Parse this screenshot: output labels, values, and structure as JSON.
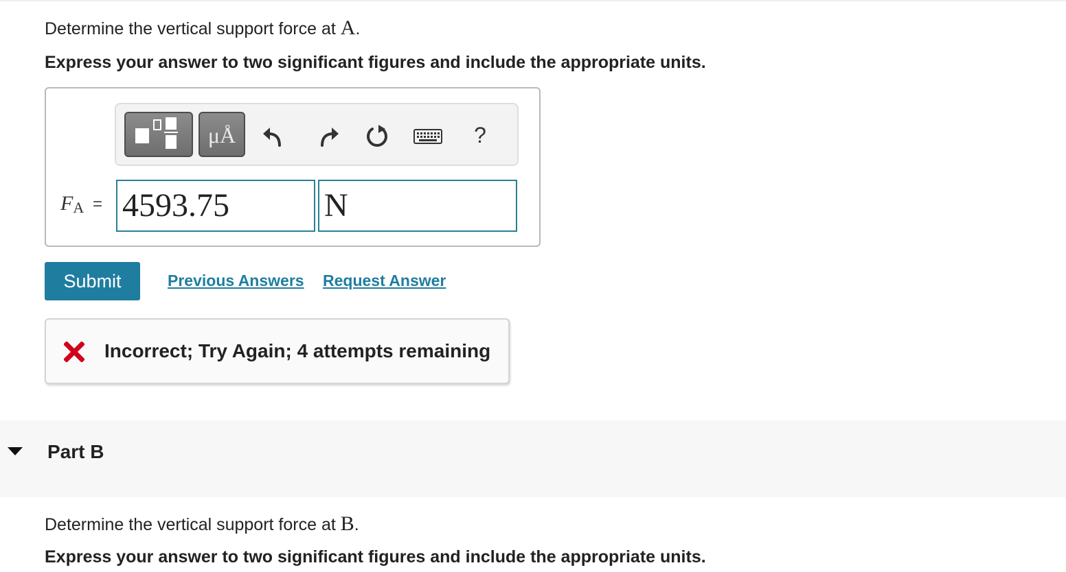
{
  "part_a": {
    "question_prefix": "Determine the vertical support force at",
    "question_point": "A",
    "question_suffix": ".",
    "instruction": "Express your answer to two significant figures and include the appropriate units.",
    "toolbar": {
      "templates_icon": "fraction-templates-icon",
      "units_label": "μÅ",
      "undo_icon": "undo-icon",
      "redo_icon": "redo-icon",
      "reset_icon": "reset-icon",
      "keyboard_icon": "keyboard-icon",
      "help_label": "?"
    },
    "answer": {
      "variable": "F",
      "subscript": "A",
      "equals": "=",
      "value": "4593.75",
      "unit": "N"
    },
    "submit_label": "Submit",
    "previous_answers_label": "Previous Answers",
    "request_answer_label": "Request Answer",
    "feedback": {
      "icon": "x-mark-icon",
      "text": "Incorrect; Try Again; 4 attempts remaining"
    }
  },
  "part_b": {
    "title": "Part B",
    "question_prefix": "Determine the vertical support force at",
    "question_point": "B",
    "question_suffix": ".",
    "instruction": "Express your answer to two significant figures and include the appropriate units."
  },
  "colors": {
    "accent": "#1f7da0",
    "error": "#d0021b",
    "field_border": "#2a7f96"
  }
}
